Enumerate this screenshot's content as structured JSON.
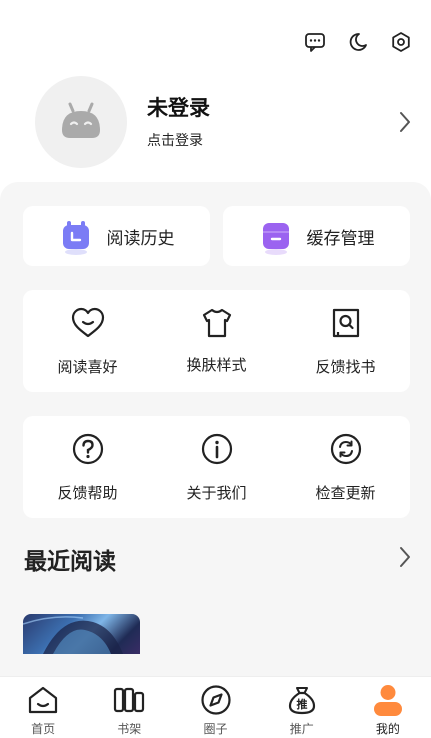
{
  "topbar": {
    "icons": [
      "message-icon",
      "moon-icon",
      "settings-icon"
    ]
  },
  "profile": {
    "name": "未登录",
    "subtitle": "点击登录"
  },
  "quick_actions": [
    {
      "label": "阅读历史",
      "icon": "history-icon",
      "color": "#7b7cf5"
    },
    {
      "label": "缓存管理",
      "icon": "cache-icon",
      "color": "#9b63f0"
    }
  ],
  "grid1": [
    {
      "label": "阅读喜好",
      "icon": "heart-icon"
    },
    {
      "label": "换肤样式",
      "icon": "shirt-icon"
    },
    {
      "label": "反馈找书",
      "icon": "book-search-icon"
    }
  ],
  "grid2": [
    {
      "label": "反馈帮助",
      "icon": "help-icon"
    },
    {
      "label": "关于我们",
      "icon": "info-icon"
    },
    {
      "label": "检查更新",
      "icon": "refresh-icon"
    }
  ],
  "recent": {
    "title": "最近阅读"
  },
  "tabbar": [
    {
      "label": "首页",
      "icon": "home-icon"
    },
    {
      "label": "书架",
      "icon": "bookshelf-icon"
    },
    {
      "label": "圈子",
      "icon": "compass-icon"
    },
    {
      "label": "推广",
      "icon": "promo-bag-icon"
    },
    {
      "label": "我的",
      "icon": "profile-icon",
      "active": true,
      "accent": "#ff8a3d"
    }
  ]
}
